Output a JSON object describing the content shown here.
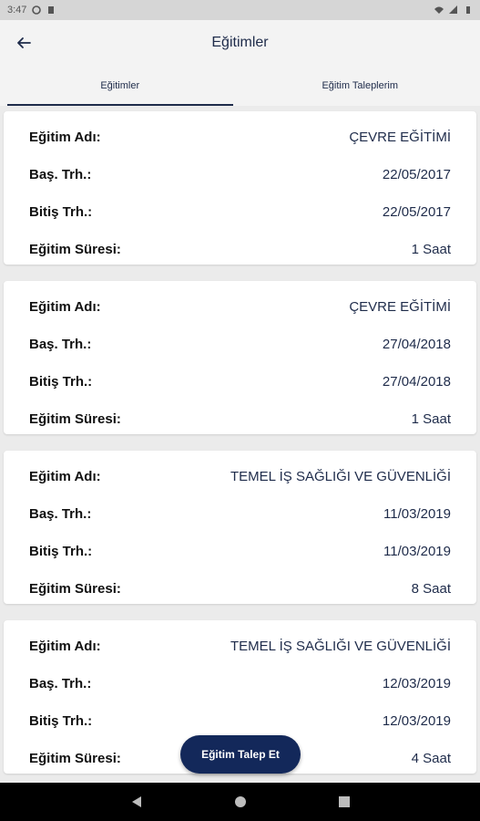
{
  "status_bar": {
    "time": "3:47"
  },
  "app_bar": {
    "title": "Eğitimler",
    "back_icon": "arrow-left-icon"
  },
  "tabs": [
    {
      "label": "Eğitimler",
      "active": true
    },
    {
      "label": "Eğitim Taleplerim",
      "active": false
    }
  ],
  "labels": {
    "name": "Eğitim Adı:",
    "start": "Baş. Trh.:",
    "end": "Bitiş Trh.:",
    "duration": "Eğitim Süresi:"
  },
  "cards": [
    {
      "name": "ÇEVRE EĞİTİMİ",
      "start": "22/05/2017",
      "end": "22/05/2017",
      "duration": "1 Saat"
    },
    {
      "name": "ÇEVRE EĞİTİMİ",
      "start": "27/04/2018",
      "end": "27/04/2018",
      "duration": "1 Saat"
    },
    {
      "name": "TEMEL İŞ SAĞLIĞI VE GÜVENLİĞİ",
      "start": "11/03/2019",
      "end": "11/03/2019",
      "duration": "8 Saat"
    },
    {
      "name": "TEMEL İŞ SAĞLIĞI VE GÜVENLİĞİ",
      "start": "12/03/2019",
      "end": "12/03/2019",
      "duration": "4 Saat"
    }
  ],
  "fab": {
    "label": "Eğitim Talep Et"
  },
  "colors": {
    "accent": "#13285a",
    "value_text": "#1e2b4a",
    "background": "#ebebeb"
  }
}
